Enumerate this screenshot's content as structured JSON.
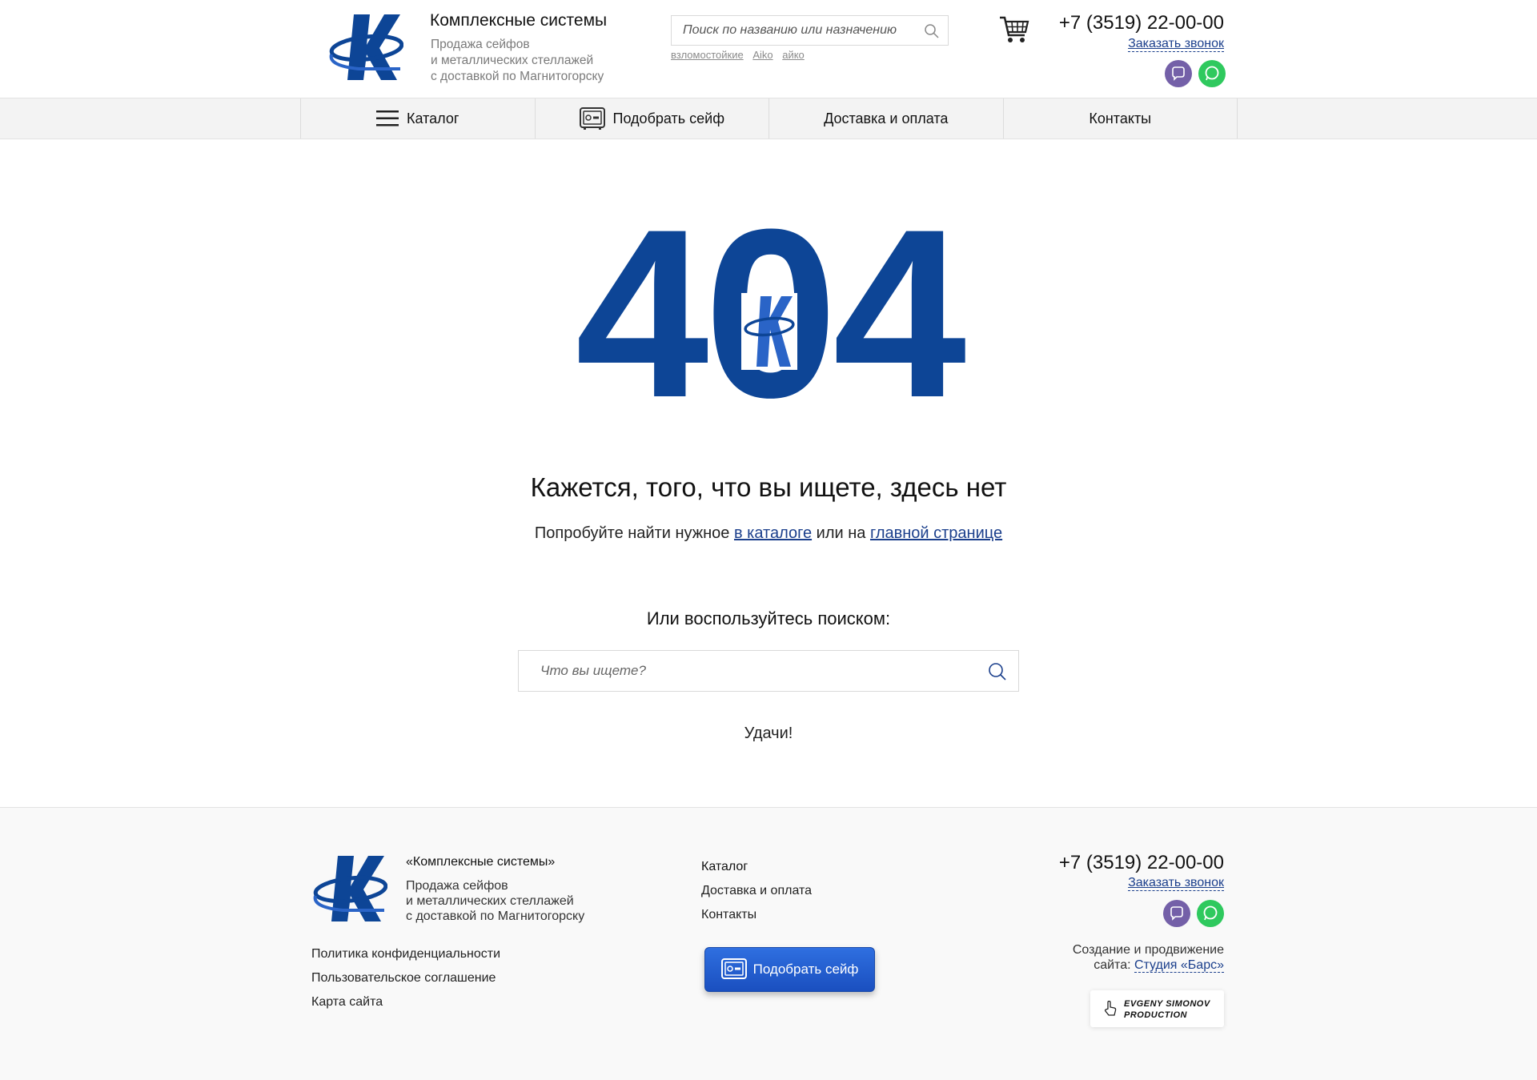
{
  "header": {
    "brand_title": "Комплексные системы",
    "brand_sub": [
      "Продажа сейфов",
      "и металлических стеллажей",
      "с доставкой по Магнитогорску"
    ],
    "search_placeholder": "Поиск по названию или назначению",
    "search_tags": [
      "взломостойкие",
      "Aiko",
      "айко"
    ],
    "phone": "+7 (3519) 22-00-00",
    "call_label": "Заказать звонок"
  },
  "nav": {
    "items": [
      {
        "label": "Каталог",
        "icon": "hamburger-icon"
      },
      {
        "label": "Подобрать сейф",
        "icon": "safe-icon"
      },
      {
        "label": "Доставка и оплата"
      },
      {
        "label": "Контакты"
      }
    ]
  },
  "main": {
    "code": "404",
    "heading": "Кажется, того, что вы ищете, здесь нет",
    "hint_prefix": "Попробуйте найти нужное",
    "hint_catalog_link": "в каталоге",
    "hint_middle": "или на",
    "hint_home_link": "главной странице",
    "or_search": "Или воспользуйтесь поиском:",
    "search_placeholder": "Что вы ищете?",
    "luck": "Удачи!"
  },
  "footer": {
    "brand": "«Комплексные системы»",
    "sub": [
      "Продажа сейфов",
      "и металлических стеллажей",
      "с доставкой по Магнитогорску"
    ],
    "links": [
      "Политика конфиденциальности",
      "Пользовательское соглашение",
      "Карта сайта"
    ],
    "menu": [
      "Каталог",
      "Доставка и оплата",
      "Контакты"
    ],
    "pick_button": "Подобрать сейф",
    "phone": "+7 (3519) 22-00-00",
    "call_label": "Заказать звонок",
    "studio_line1": "Создание и продвижение",
    "studio_prefix": "сайта:",
    "studio_link": "Студия «Барс»",
    "badge_line1": "EVGENY SIMONOV",
    "badge_line2": "PRODUCTION"
  },
  "colors": {
    "brand_blue": "#0d4596",
    "link_blue": "#1b3f8c",
    "viber": "#7460a8",
    "whatsapp": "#2fc95e"
  }
}
